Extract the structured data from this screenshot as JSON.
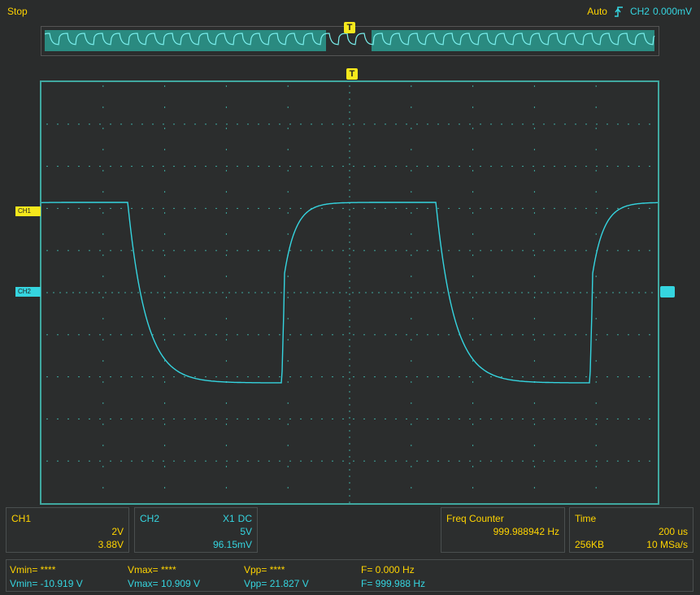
{
  "status": "Stop",
  "trigger": {
    "mode": "Auto",
    "source": "CH2",
    "level": "0.000mV",
    "marker": "T"
  },
  "channel_markers": {
    "ch1": "CH1",
    "ch2": "CH2"
  },
  "ch1_panel": {
    "title": "CH1",
    "scale": "2V",
    "offset": "3.88V"
  },
  "ch2_panel": {
    "title": "CH2",
    "probe": "X1",
    "coupling": "DC",
    "scale": "5V",
    "offset": "96.15mV"
  },
  "freq_counter": {
    "title": "Freq Counter",
    "value": "999.988942 Hz"
  },
  "time_panel": {
    "title": "Time",
    "timebase": "200 us",
    "memory": "256KB",
    "sample_rate": "10 MSa/s"
  },
  "measurements": {
    "row1": {
      "vmin": "Vmin= ****",
      "vmax": "Vmax= ****",
      "vpp": "Vpp= ****",
      "f": "F= 0.000 Hz"
    },
    "row2": {
      "vmin": "Vmin= -10.919 V",
      "vmax": "Vmax= 10.909 V",
      "vpp": "Vpp= 21.827 V",
      "f": "F= 999.988 Hz"
    }
  },
  "colors": {
    "ch1": "#ffd400",
    "ch2": "#35d5e0",
    "grid_border": "#40a8a0"
  }
}
